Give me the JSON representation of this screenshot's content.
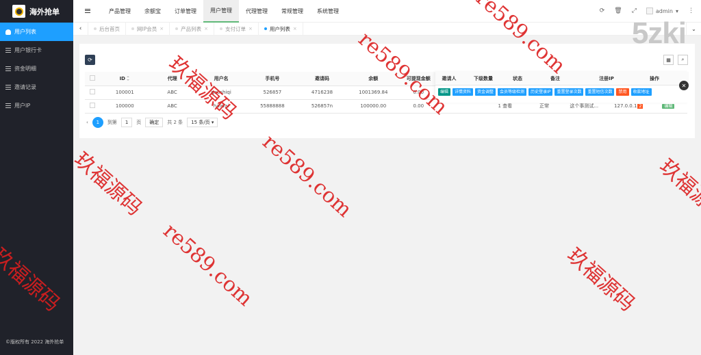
{
  "app": {
    "title": "海外抢单",
    "copyright": "©版权所有 2022 海外抢单"
  },
  "sidebar": {
    "items": [
      {
        "label": "用户列表",
        "icon": "user-icon",
        "active": true
      },
      {
        "label": "用户银行卡",
        "icon": "list-icon"
      },
      {
        "label": "资金明细",
        "icon": "list-icon"
      },
      {
        "label": "邀请记录",
        "icon": "list-icon"
      },
      {
        "label": "用户IP",
        "icon": "list-icon"
      }
    ]
  },
  "topnav": {
    "items": [
      "产品管理",
      "余额宝",
      "订单管理",
      "用户管理",
      "代理管理",
      "常规管理",
      "系统管理"
    ],
    "active": "用户管理"
  },
  "header": {
    "admin": "admin",
    "refresh": "⟳",
    "clear": "🗑",
    "fullscreen": "⤢",
    "more": "⋮",
    "dropdown": "▾"
  },
  "tabs": {
    "left_arrow": "‹",
    "right_arrow": "⌄",
    "items": [
      {
        "label": "后台首页",
        "closable": false
      },
      {
        "label": "网IP会员",
        "closable": true
      },
      {
        "label": "产品列表",
        "closable": true
      },
      {
        "label": "支付订单",
        "closable": true
      },
      {
        "label": "用户列表",
        "closable": true,
        "active": true
      }
    ]
  },
  "brand": "5zki",
  "toolbar": {
    "refresh": "⟳",
    "columns": "▦",
    "search": "⌕"
  },
  "table": {
    "headers": [
      "ID",
      "代理",
      "用户名",
      "手机号",
      "邀请码",
      "余额",
      "可提现金额",
      "邀请人",
      "下级数量",
      "状态",
      "备注",
      "注册IP",
      "操作"
    ],
    "rows": [
      {
        "id": "100001",
        "agent": "ABC",
        "username": "gaoshiqi",
        "phone": "526857",
        "code": "4716238",
        "balance": "1001369.84",
        "withdrawable": "0.00",
        "inviter": "",
        "sub": "",
        "status": "",
        "note": "",
        "ip": ""
      },
      {
        "id": "100000",
        "agent": "ABC",
        "username": "haiwai",
        "phone": "55888888",
        "code": "526857n",
        "balance": "100000.00",
        "withdrawable": "0.00",
        "inviter": "",
        "sub": "1 查看",
        "status": "正常",
        "note": "这个事测试...",
        "ip": "127.0.0.1",
        "ip_badge": "2"
      }
    ],
    "row1_buttons": [
      "编辑",
      "详情资料",
      "资金调整",
      "会员等级检测",
      "历史登录IP",
      "重置登录次数",
      "重置短信次数",
      "禁用",
      "收款地址"
    ],
    "row2_buttons": [
      "编辑"
    ],
    "close": "✕"
  },
  "pager": {
    "current": "1",
    "goto": "到第",
    "page_input": "1",
    "page_unit": "页",
    "confirm": "确定",
    "total": "共 2 条",
    "per_page": "15 条/页",
    "prev": "‹"
  },
  "watermarks": [
    "玖福源码",
    "re589.com"
  ]
}
